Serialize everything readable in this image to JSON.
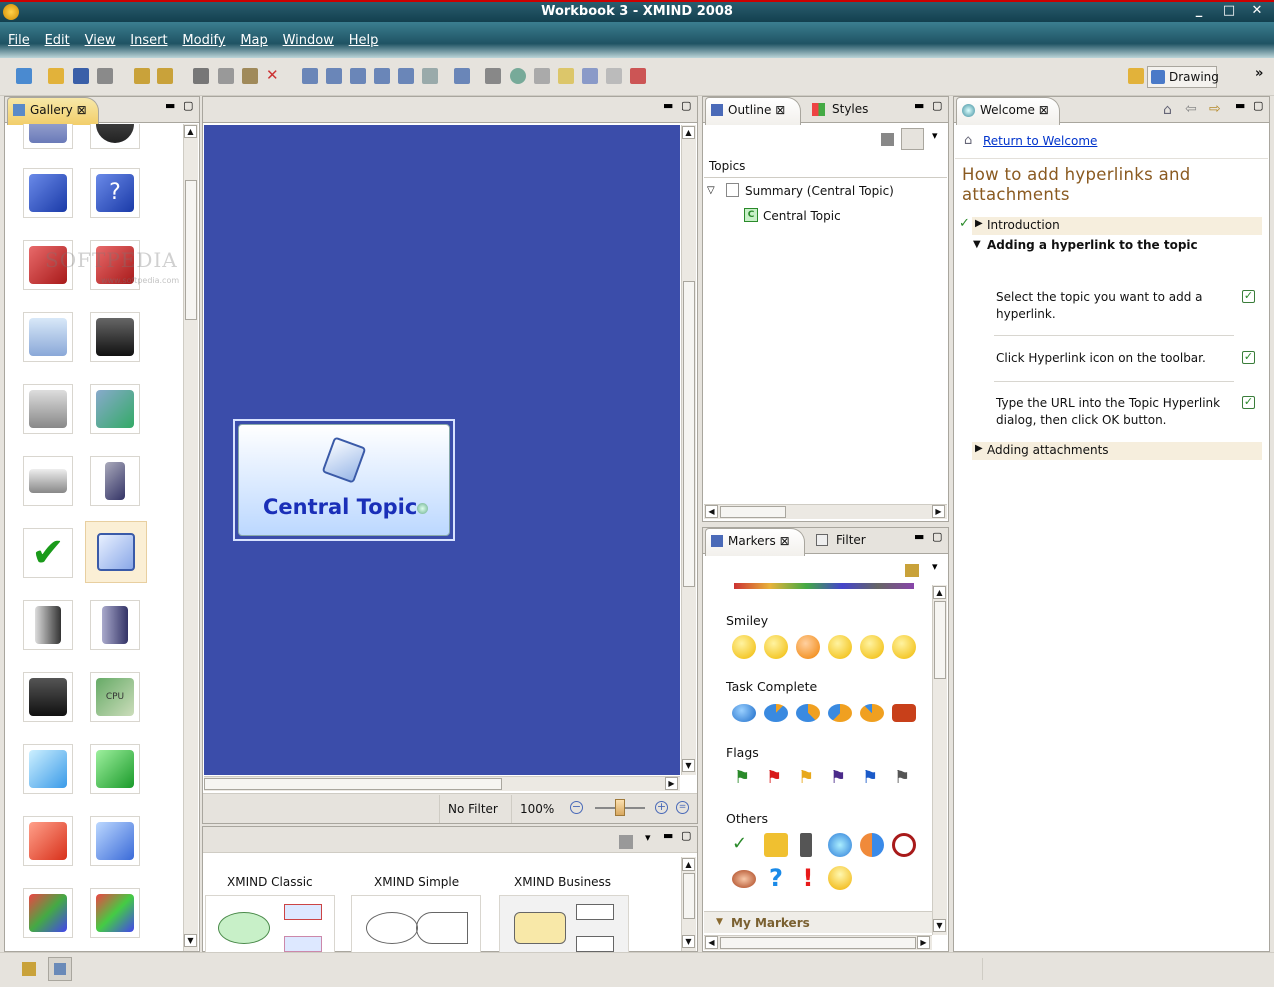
{
  "window": {
    "title": "Workbook 3 - XMIND 2008",
    "controls": [
      "_",
      "□",
      "✕"
    ]
  },
  "menu": [
    "File",
    "Edit",
    "View",
    "Insert",
    "Modify",
    "Map",
    "Window",
    "Help"
  ],
  "toolbar": {
    "drawing_label": "Drawing",
    "overflow": "»"
  },
  "gallery": {
    "tab": "Gallery",
    "close": "⊠",
    "watermark": "SOFTPEDIA",
    "watermark_url": "www.softpedia.com"
  },
  "canvas": {
    "central_topic": "Central Topic",
    "filter": "No Filter",
    "zoom": "100%",
    "bg": "#3b4daa"
  },
  "templates": [
    "XMIND Classic",
    "XMIND Simple",
    "XMIND Business"
  ],
  "outline": {
    "tab": "Outline",
    "tab2": "Styles",
    "header": "Topics",
    "summary": "Summary (Central Topic)",
    "child": "Central Topic"
  },
  "markers": {
    "tab": "Markers",
    "tab2": "Filter",
    "groups": [
      "Smiley",
      "Task Complete",
      "Flags",
      "Others"
    ],
    "my": "My Markers"
  },
  "welcome": {
    "tab": "Welcome",
    "return": "Return to Welcome",
    "title": "How to add hyperlinks and attachments",
    "intro": "Introduction",
    "section": "Adding a hyperlink to the topic",
    "steps": [
      "Select the topic you want to add a hyperlink.",
      "Click Hyperlink icon on the toolbar.",
      "Type the URL into the Topic Hyperlink dialog, then click OK button."
    ],
    "attach": "Adding attachments"
  }
}
